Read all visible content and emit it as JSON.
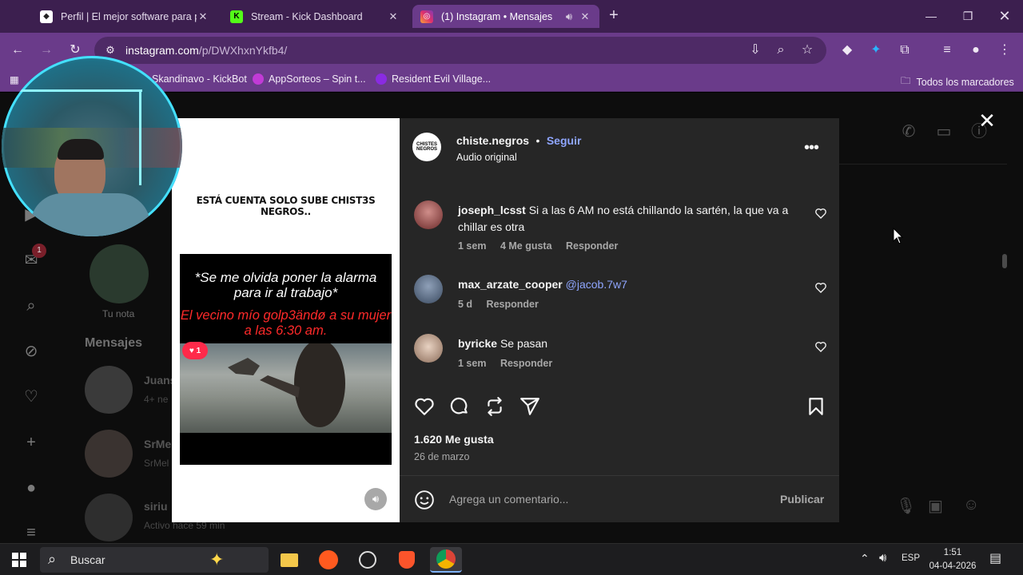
{
  "browser": {
    "tabs": [
      {
        "title": "Perfil | El mejor software para p",
        "favicon": "diamond-icon",
        "active": false
      },
      {
        "title": "Stream - Kick Dashboard",
        "favicon": "kick-icon",
        "active": false
      },
      {
        "title": "(1) Instagram • Mensajes",
        "favicon": "instagram-icon",
        "active": true
      }
    ],
    "url_host": "instagram.com",
    "url_path": "/p/DWXhxnYkfb4/",
    "bookmarks": [
      {
        "label": "Skandinavo - KickBot",
        "color": "#55d05a"
      },
      {
        "label": "AppSorteos – Spin t...",
        "color": "#c13bd6"
      },
      {
        "label": "Resident Evil Village...",
        "color": "#8a2be2"
      }
    ],
    "all_bookmarks_label": "Todos los marcadores"
  },
  "instagram": {
    "background": {
      "note_label": "Tu nota",
      "messages_heading": "Mensajes",
      "notif_count": "1",
      "conversations": [
        {
          "name": "Juans",
          "sub": "4+ ne"
        },
        {
          "name": "SrMe",
          "sub": "SrMel"
        },
        {
          "name": "siriu",
          "sub": "Activo hace 59 min"
        }
      ]
    },
    "post": {
      "media_caption": "ESTÁ CUENTA SOLO SUBE CHIST3S NEGROS..",
      "video_text_white": "*Se me olvida poner la alarma para ir al trabajo*",
      "video_text_red": "El vecino mío golp3ändø a su mujer a las 6:30 am.",
      "heart_badge_count": "1",
      "author": "chiste.negros",
      "follow_label": "Seguir",
      "separator": "•",
      "audio_label": "Audio original",
      "avatar_text": "CHISTES NEGROS",
      "comments": [
        {
          "user": "joseph_lcsst",
          "text": "Si a las 6 AM no está chillando la sartén, la que va a chillar es otra",
          "time": "1 sem",
          "likes": "4 Me gusta",
          "reply": "Responder"
        },
        {
          "user": "max_arzate_cooper",
          "mention": "@jacob.7w7",
          "time": "5 d",
          "reply": "Responder"
        },
        {
          "user": "byricke",
          "text": "Se pasan",
          "time": "1 sem",
          "reply": "Responder"
        }
      ],
      "likes_count": "1.620 Me gusta",
      "date": "26 de marzo",
      "comment_placeholder": "Agrega un comentario...",
      "publish_label": "Publicar"
    }
  },
  "taskbar": {
    "search_label": "Buscar",
    "language": "ESP",
    "time": "1:51",
    "date": "04-04-2026"
  },
  "colors": {
    "tab_strip": "#3c1f4f",
    "toolbar": "#6a3b8a",
    "ig_panel": "#262626",
    "link_blue": "#8fa6ff",
    "badge_red": "#ff2a4a"
  }
}
